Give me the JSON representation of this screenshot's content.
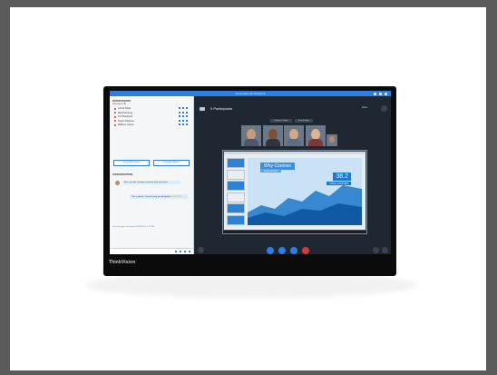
{
  "window": {
    "title": "Conversation with Participants"
  },
  "left_panel": {
    "participants_header": "PARTICIPANTS",
    "attendees_label": "Attendees (5)",
    "participants": [
      {
        "name": "Lorrick Tippel"
      },
      {
        "name": "Molly Dempsey"
      },
      {
        "name": "Jim Hildebrand"
      },
      {
        "name": "Kiranbi Natbrove"
      },
      {
        "name": "Matthew Yanson"
      }
    ],
    "invite_button": "Invite More People",
    "actions_button": "Participant Actions",
    "conversation_header": "CONVERSATION",
    "message_1": "Nice, give the customer someone who may share",
    "message_2": "This is perfect. I love the way you designed it.",
    "rating_stars": "★★★★★",
    "last_message": "Last message received on 5/2/2018 at 1:11 PM"
  },
  "stage": {
    "participants_title": "5 Participants",
    "chip_1": "Request Control",
    "chip_2": "Stop Sharing",
    "more_label": "More",
    "slide_heading": "Why Contoso",
    "slide_subheading": "Cloud Growth",
    "stat_big": "38.2",
    "stat_small": "TOTAL VISITORS"
  },
  "colors": {
    "accent": "#2d7ee0",
    "hangup": "#d63b3b",
    "stage_bg": "#1f2732"
  },
  "brand": "ThinkVision"
}
